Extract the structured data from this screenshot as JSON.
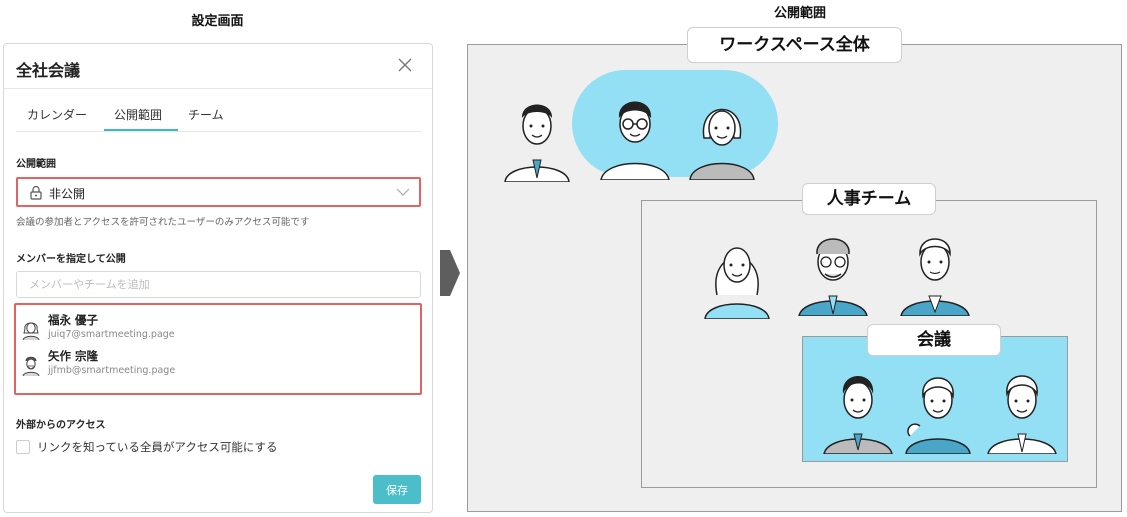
{
  "captions": {
    "left": "設定画面",
    "right": "公開範囲"
  },
  "dialog": {
    "title": "全社会議",
    "tabs": [
      {
        "label": "カレンダー"
      },
      {
        "label": "公開範囲"
      },
      {
        "label": "チーム"
      }
    ],
    "active_tab": "公開範囲",
    "scope": {
      "label": "公開範囲",
      "selected": "非公開",
      "note": "会議の参加者とアクセスを許可されたユーザーのみアクセス可能です"
    },
    "members": {
      "label": "メンバーを指定して公開",
      "placeholder": "メンバーやチームを追加",
      "list": [
        {
          "name": "福永 優子",
          "email": "juiq7@smartmeeting.page"
        },
        {
          "name": "矢作 宗隆",
          "email": "jjfmb@smartmeeting.page"
        }
      ]
    },
    "external": {
      "label": "外部からのアクセス",
      "checkbox_label": "リンクを知っている全員がアクセス可能にする",
      "checked": false
    },
    "save_label": "保存"
  },
  "diagram": {
    "groups": [
      {
        "label": "ワークスペース全体",
        "highlighted": false
      },
      {
        "label": "人事チーム",
        "highlighted": false
      },
      {
        "label": "会議",
        "highlighted": true
      }
    ],
    "colors": {
      "highlight": "#93e0f5",
      "group_bg": "#efefef",
      "accent_tie": "#4aa6c8"
    }
  },
  "colors": {
    "accent": "#4cbec9",
    "tab_underline": "#3fb8c6",
    "emphasis_border": "#e06464"
  }
}
